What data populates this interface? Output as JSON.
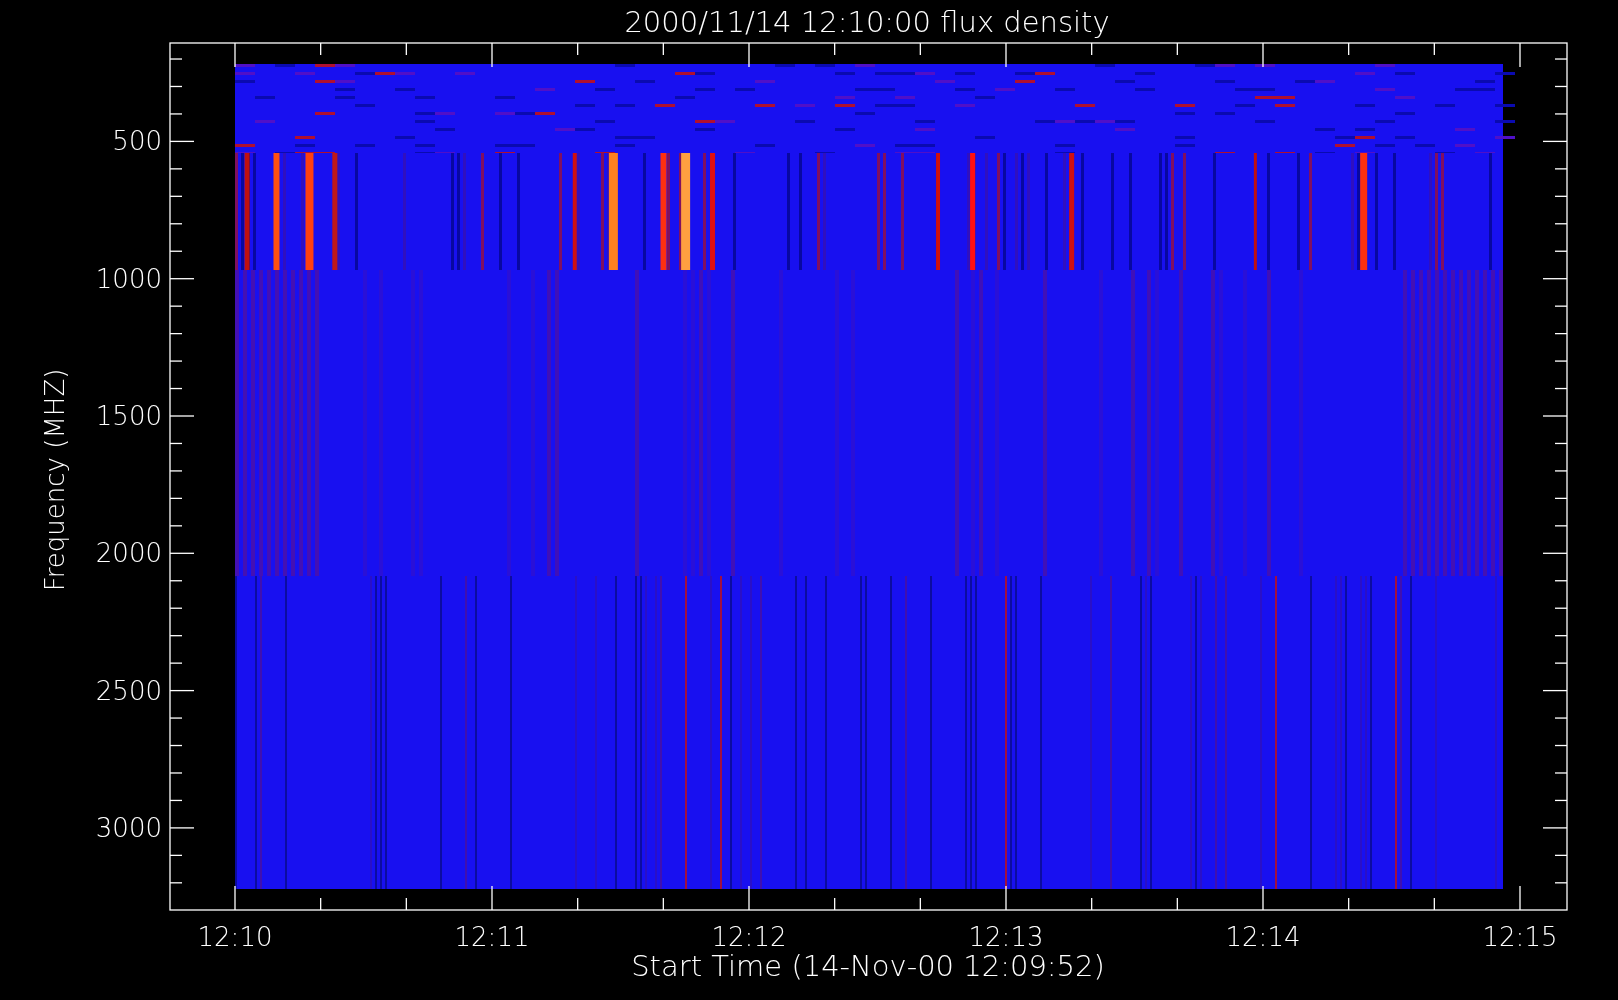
{
  "plot": {
    "title": "2000/11/14 12:10:00 flux density",
    "ylabel": "Frequency (MHZ)",
    "xlabel": "Start Time (14-Nov-00 12:09:52)",
    "yticks": [
      "500",
      "1000",
      "1500",
      "2000",
      "2500",
      "3000"
    ],
    "xticks": [
      "12:10",
      "12:11",
      "12:12",
      "12:13",
      "12:14",
      "12:15"
    ]
  }
}
